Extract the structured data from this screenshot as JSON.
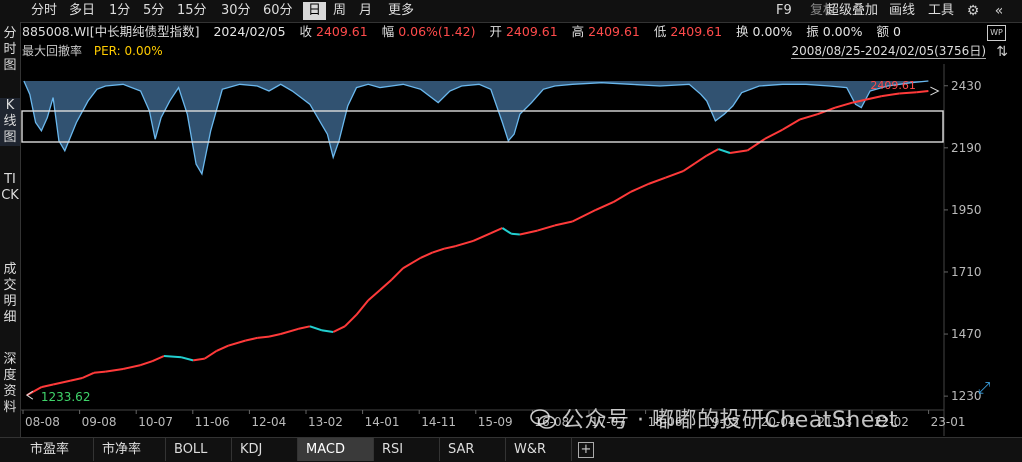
{
  "toolbar": {
    "periods": [
      "分时",
      "多日",
      "1分",
      "5分",
      "15分",
      "30分",
      "60分",
      "日",
      "周",
      "月",
      "更多"
    ],
    "active_period": "日",
    "right": {
      "f9": "F9",
      "fuquan": "复权",
      "overlay": "超级叠加",
      "draw": "画线",
      "tools": "工具"
    }
  },
  "sidebar": {
    "tabs": [
      "分时图",
      "K线图",
      "TICK",
      "成交明细",
      "深度资料"
    ],
    "selected": "K线图"
  },
  "info": {
    "code": "885008.WI[中长期纯债型指数]",
    "date": "2024/02/05",
    "close_label": "收",
    "close": "2409.61",
    "chg_label": "幅",
    "chg": "0.06%(1.42)",
    "open_label": "开",
    "open": "2409.61",
    "high_label": "高",
    "high": "2409.61",
    "low_label": "低",
    "low": "2409.61",
    "turnover_label": "换",
    "turnover": "0.00%",
    "amp_label": "振",
    "amp": "0.00%",
    "amount_label": "额",
    "amount": "0"
  },
  "indicator": {
    "name": "最大回撤率",
    "per_label": "PER: 0.00%"
  },
  "range": "2008/08/25-2024/02/05(3756日)",
  "chart_data": {
    "type": "line",
    "x_tick_labels": [
      "08-08",
      "09-08",
      "10-07",
      "11-06",
      "12-04",
      "13-02",
      "14-01",
      "14-11",
      "15-09",
      "16-08",
      "17-07",
      "18-06",
      "19-05",
      "20-04",
      "21-03",
      "22-02",
      "23-01"
    ],
    "y_ticks": [
      1230,
      1470,
      1710,
      1950,
      2190,
      2430
    ],
    "ylim": [
      1215,
      2460
    ],
    "series": [
      {
        "x": [
          2008.65,
          2008.9,
          2009.1,
          2009.4,
          2009.6,
          2009.8,
          2010.0,
          2010.3,
          2010.6,
          2010.8,
          2011.0,
          2011.3,
          2011.5,
          2011.7,
          2011.9,
          2012.1,
          2012.4,
          2012.6,
          2012.8,
          2013.0,
          2013.3,
          2013.5,
          2013.7,
          2013.9,
          2014.1,
          2014.3,
          2014.5,
          2014.7,
          2014.9,
          2015.1,
          2015.4,
          2015.6,
          2015.8,
          2016.0,
          2016.3,
          2016.6,
          2016.8,
          2016.95,
          2017.1,
          2017.4,
          2017.7,
          2018.0,
          2018.4,
          2018.7,
          2019.0,
          2019.3,
          2019.6,
          2019.9,
          2020.1,
          2020.3,
          2020.5,
          2020.7,
          2021.0,
          2021.3,
          2021.6,
          2021.9,
          2022.2,
          2022.5,
          2022.8,
          2023.0,
          2023.3,
          2023.6,
          2023.9,
          2024.1
        ],
        "y": [
          1233.62,
          1265,
          1275,
          1290,
          1300,
          1320,
          1325,
          1335,
          1350,
          1365,
          1385,
          1380,
          1368,
          1375,
          1405,
          1425,
          1445,
          1455,
          1460,
          1470,
          1490,
          1500,
          1485,
          1478,
          1500,
          1545,
          1600,
          1640,
          1680,
          1725,
          1765,
          1785,
          1800,
          1810,
          1830,
          1860,
          1880,
          1858,
          1855,
          1870,
          1890,
          1905,
          1950,
          1980,
          2020,
          2050,
          2075,
          2100,
          2130,
          2160,
          2185,
          2170,
          2180,
          2225,
          2260,
          2300,
          2320,
          2345,
          2365,
          2375,
          2390,
          2400,
          2405,
          2409.61
        ],
        "last_label": "2409.61",
        "first_label": "1233.62",
        "colors": {
          "up": "#ff3a3a",
          "down": "#22cfd0"
        }
      },
      {
        "name": "最大回撤率",
        "color": "#6ab8ee",
        "x": [
          2008.6,
          2008.7,
          2008.8,
          2008.9,
          2009.0,
          2009.1,
          2009.2,
          2009.3,
          2009.5,
          2009.7,
          2009.85,
          2010.0,
          2010.3,
          2010.6,
          2010.75,
          2010.85,
          2010.95,
          2011.1,
          2011.25,
          2011.4,
          2011.55,
          2011.65,
          2011.8,
          2012.0,
          2012.3,
          2012.6,
          2012.8,
          2013.0,
          2013.2,
          2013.35,
          2013.5,
          2013.6,
          2013.7,
          2013.8,
          2013.9,
          2014.0,
          2014.15,
          2014.3,
          2014.5,
          2014.7,
          2014.9,
          2015.1,
          2015.4,
          2015.7,
          2015.9,
          2016.1,
          2016.4,
          2016.6,
          2016.8,
          2016.9,
          2017.0,
          2017.1,
          2017.3,
          2017.5,
          2017.7,
          2018.0,
          2018.5,
          2019.0,
          2019.5,
          2020.0,
          2020.2,
          2020.3,
          2020.45,
          2020.6,
          2020.75,
          2020.9,
          2021.2,
          2021.6,
          2022.0,
          2022.4,
          2022.7,
          2022.85,
          2022.95,
          2023.1,
          2023.4,
          2023.8,
          2024.1
        ],
        "y": [
          0,
          -0.8,
          -2.5,
          -3.0,
          -2.2,
          -1.0,
          -3.6,
          -4.2,
          -2.5,
          -1.2,
          -0.5,
          -0.3,
          -0.2,
          -0.6,
          -1.8,
          -3.5,
          -2.2,
          -1.2,
          -0.4,
          -2.0,
          -5.0,
          -5.6,
          -3.0,
          -0.5,
          -0.2,
          -0.3,
          -0.6,
          -0.2,
          -0.6,
          -1.0,
          -1.4,
          -2.0,
          -2.6,
          -3.2,
          -4.6,
          -3.6,
          -1.5,
          -0.4,
          -0.2,
          -0.4,
          -0.3,
          -0.2,
          -0.5,
          -1.3,
          -0.6,
          -0.3,
          -0.2,
          -0.5,
          -2.5,
          -3.6,
          -3.2,
          -2.0,
          -1.3,
          -0.5,
          -0.3,
          -0.2,
          -0.1,
          -0.2,
          -0.3,
          -0.2,
          -0.8,
          -1.2,
          -2.4,
          -2.0,
          -1.5,
          -0.7,
          -0.3,
          -0.2,
          -0.2,
          -0.3,
          -0.4,
          -1.4,
          -1.6,
          -0.6,
          -0.3,
          -0.1,
          0
        ],
        "ylim": [
          -6.5,
          0
        ]
      }
    ]
  },
  "bottom_tabs": [
    "市盈率",
    "市净率",
    "BOLL",
    "KDJ",
    "MACD",
    "RSI",
    "SAR",
    "W&R"
  ],
  "active_tab": "MACD",
  "watermark": "公众号 · 嘟嘟的投研CheatSheet"
}
